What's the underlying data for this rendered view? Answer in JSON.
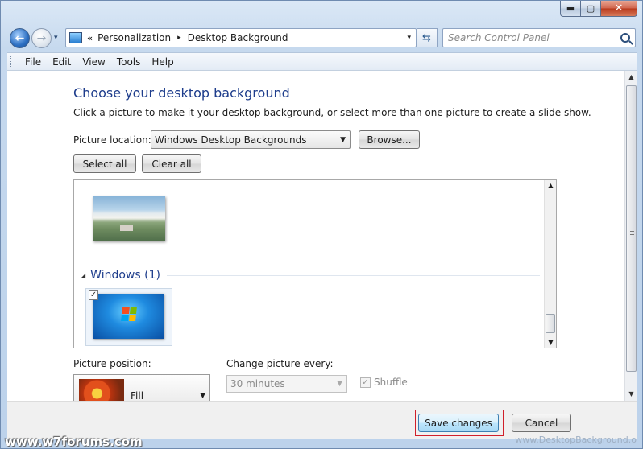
{
  "window": {
    "caption": {
      "minimize": "▬",
      "maximize": "▢",
      "close": "✕"
    }
  },
  "nav": {
    "back": "←",
    "forward": "→",
    "history": "▾",
    "address": {
      "chevron": "«",
      "segments": [
        "Personalization",
        "Desktop Background"
      ],
      "separator": "▸",
      "dropdown": "▾"
    },
    "refresh": "⇆",
    "search_placeholder": "Search Control Panel"
  },
  "menu": [
    "File",
    "Edit",
    "View",
    "Tools",
    "Help"
  ],
  "content": {
    "title": "Choose your desktop background",
    "intro": "Click a picture to make it your desktop background, or select more than one picture to create a slide show.",
    "location_label": "Picture location:",
    "location_value": "Windows Desktop Backgrounds",
    "browse_label": "Browse...",
    "select_all_label": "Select all",
    "clear_all_label": "Clear all",
    "group_title": "Windows (1)",
    "group_toggle": "◢",
    "position_label": "Picture position:",
    "position_value": "Fill",
    "change_label": "Change picture every:",
    "interval_value": "30 minutes",
    "shuffle_label": "Shuffle",
    "check_mark": "✓"
  },
  "footer": {
    "save_label": "Save changes",
    "cancel_label": "Cancel"
  },
  "watermarks": {
    "left": "www.w7forums.com",
    "right": "www.DesktopBackground.o"
  },
  "colors": {
    "title_blue": "#1e3d8c",
    "highlight_red": "#d01f2a"
  }
}
